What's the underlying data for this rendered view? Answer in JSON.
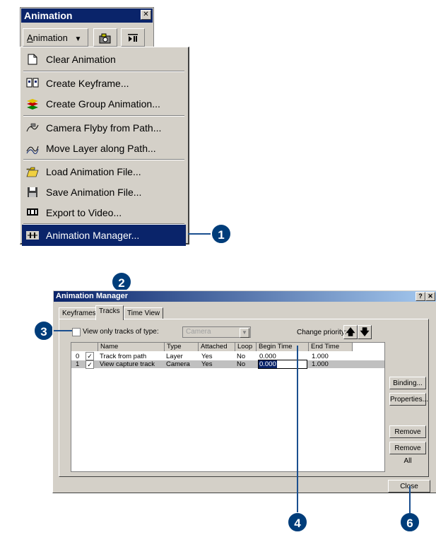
{
  "toolbar": {
    "title": "Animation",
    "close_glyph": "✕",
    "menu_button": {
      "prefix": "A",
      "rest": "nimation",
      "arrow": "▼"
    },
    "camera_icon": "camera-icon",
    "play_icon": "play-pause-icon"
  },
  "menu": {
    "items": [
      {
        "label": "Clear Animation",
        "icon": "clear-icon"
      },
      {
        "label": "Create Keyframe...",
        "icon": "keyframe-icon"
      },
      {
        "label": "Create Group Animation...",
        "icon": "group-animation-icon"
      },
      {
        "label": "Camera Flyby from Path...",
        "icon": "camera-flyby-icon"
      },
      {
        "label": "Move Layer along Path...",
        "icon": "move-layer-icon"
      },
      {
        "label": "Load Animation File...",
        "icon": "folder-open-icon"
      },
      {
        "label": "Save Animation File...",
        "icon": "save-icon"
      },
      {
        "label": "Export to Video...",
        "icon": "film-icon"
      },
      {
        "label": "Animation Manager...",
        "icon": "animation-manager-icon",
        "selected": true
      }
    ]
  },
  "callouts": {
    "c1": "1",
    "c2": "2",
    "c3": "3",
    "c4": "4",
    "c6": "6"
  },
  "dialog": {
    "title": "Animation Manager",
    "help_glyph": "?",
    "close_glyph": "✕",
    "tabs": [
      "Keyframes",
      "Tracks",
      "Time View"
    ],
    "view_only_label": "View only tracks of type:",
    "type_combo": "Camera",
    "change_priority_label": "Change priority:",
    "columns": [
      "Name",
      "Type",
      "Attached",
      "Loop",
      "Begin Time",
      "End Time"
    ],
    "rows": [
      {
        "index": "0",
        "name": "Track from path",
        "type": "Layer",
        "attached": "Yes",
        "loop": "No",
        "begin": "0.000",
        "end": "1.000"
      },
      {
        "index": "1",
        "name": "View capture track",
        "type": "Camera",
        "attached": "Yes",
        "loop": "No",
        "begin": "0.000",
        "end": "1.000"
      }
    ],
    "buttons": {
      "binding": "Binding...",
      "properties": "Properties...",
      "remove": "Remove",
      "remove_all": "Remove All",
      "close": "Close"
    }
  },
  "colors": {
    "title_bar": "#0a246a",
    "face": "#d4d0c8",
    "callout": "#003d7a"
  }
}
